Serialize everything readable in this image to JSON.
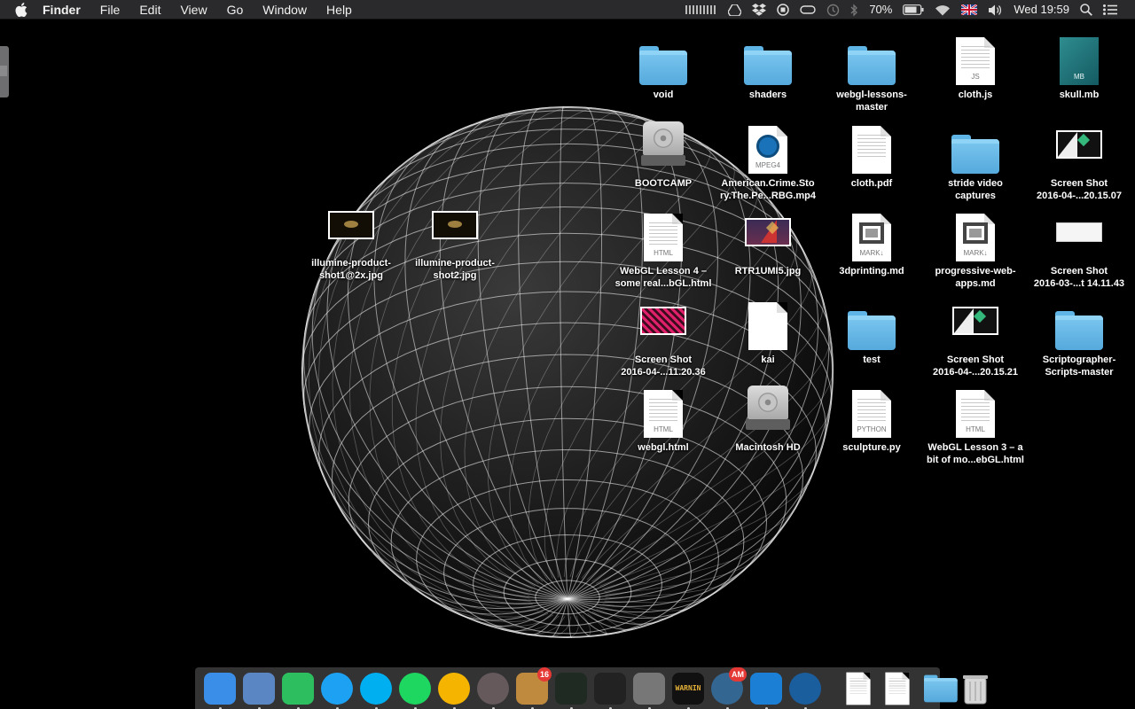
{
  "menubar": {
    "apple_icon": "apple-logo-icon",
    "app_name": "Finder",
    "menus": [
      "File",
      "Edit",
      "View",
      "Go",
      "Window",
      "Help"
    ],
    "status": {
      "battery_percent": "70%",
      "clock": "Wed 19:59",
      "icons": [
        "activity-meter-icon",
        "google-drive-icon",
        "dropbox-icon",
        "record-icon",
        "display-icon",
        "time-machine-icon",
        "bluetooth-icon",
        "battery-icon",
        "wifi-icon",
        "uk-flag-icon",
        "volume-icon",
        "spotlight-search-icon",
        "notification-center-icon"
      ]
    }
  },
  "desktop": {
    "items": [
      {
        "label": "void",
        "kind": "folder"
      },
      {
        "label": "shaders",
        "kind": "folder"
      },
      {
        "label": "webgl-lessons-\nmaster",
        "kind": "folder"
      },
      {
        "label": "cloth.js",
        "kind": "doc",
        "ext": "JS"
      },
      {
        "label": "skull.mb",
        "kind": "mb",
        "ext": "MB"
      },
      {
        "label": "BOOTCAMP",
        "kind": "drive"
      },
      {
        "label": "American.Crime.Sto\nry.The.Pe...RBG.mp4",
        "kind": "video",
        "ext": "MPEG4"
      },
      {
        "label": "cloth.pdf",
        "kind": "doc",
        "ext": ""
      },
      {
        "label": "stride video\ncaptures",
        "kind": "folder"
      },
      {
        "label": "Screen Shot\n2016-04-...20.15.07",
        "kind": "shot"
      },
      {
        "label": "WebGL Lesson 4 –\nsome real...bGL.html",
        "kind": "doc",
        "ext": "HTML"
      },
      {
        "label": "RTR1UMI5.jpg",
        "kind": "shot-figure"
      },
      {
        "label": "3dprinting.md",
        "kind": "mark",
        "ext": "MARK↓"
      },
      {
        "label": "progressive-web-\napps.md",
        "kind": "mark",
        "ext": "MARK↓"
      },
      {
        "label": "Screen Shot\n2016-03-...t 14.11.43",
        "kind": "shot-white"
      },
      {
        "label": "Screen Shot\n2016-04-...11.20.36",
        "kind": "shot-magenta"
      },
      {
        "label": "kai",
        "kind": "plain"
      },
      {
        "label": "test",
        "kind": "folder"
      },
      {
        "label": "Screen Shot\n2016-04-...20.15.21",
        "kind": "shot"
      },
      {
        "label": "Scriptographer-\nScripts-master",
        "kind": "folder"
      },
      {
        "label": "webgl.html",
        "kind": "doc",
        "ext": "HTML"
      },
      {
        "label": "Macintosh HD",
        "kind": "drive"
      },
      {
        "label": "sculpture.py",
        "kind": "doc",
        "ext": "PYTHON"
      },
      {
        "label": "WebGL Lesson 3 – a\nbit of mo...ebGL.html",
        "kind": "doc",
        "ext": "HTML"
      }
    ],
    "loose_items": [
      {
        "label": "illumine-product-\nshot1@2x.jpg"
      },
      {
        "label": "illumine-product-\nshot2.jpg"
      }
    ]
  },
  "dock": {
    "apps": [
      {
        "name": "finder-icon",
        "color": "#3b8ee8"
      },
      {
        "name": "mail-icon",
        "color": "#5b86c4"
      },
      {
        "name": "evernote-icon",
        "color": "#2dbe60"
      },
      {
        "name": "twitter-icon",
        "color": "#1da1f2"
      },
      {
        "name": "skype-icon",
        "color": "#00aff0"
      },
      {
        "name": "spotify-icon",
        "color": "#1ed760"
      },
      {
        "name": "chrome-icon",
        "color": "#f4b400"
      },
      {
        "name": "atom-icon",
        "color": "#66595c"
      },
      {
        "name": "archive-utility-icon",
        "color": "#c08a3e",
        "badge": "16"
      },
      {
        "name": "activity-monitor-icon",
        "color": "#1f2b22"
      },
      {
        "name": "terminal-icon",
        "color": "#222"
      },
      {
        "name": "system-preferences-icon",
        "color": "#777"
      },
      {
        "name": "console-icon",
        "color": "#111",
        "text": "WARNIN"
      },
      {
        "name": "postgres-elephant-icon",
        "color": "#336791",
        "badge": "AM"
      },
      {
        "name": "xcode-icon",
        "color": "#1c7fd6"
      },
      {
        "name": "quicktime-icon",
        "color": "#1b5e9e"
      }
    ],
    "stacks": [
      {
        "name": "document-stack-icon"
      },
      {
        "name": "document-stack-icon"
      },
      {
        "name": "downloads-folder-icon"
      },
      {
        "name": "trash-icon"
      }
    ]
  }
}
